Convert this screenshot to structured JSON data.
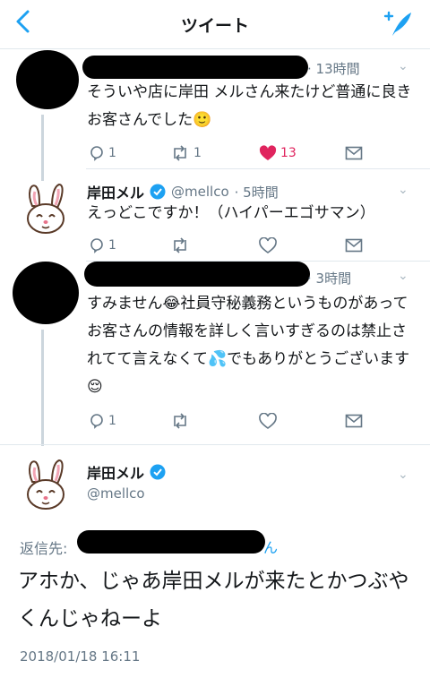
{
  "header": {
    "title": "ツイート"
  },
  "tweets": [
    {
      "time": "· 13時間",
      "text": "そういや店に岸田 メルさん来たけど普通に良きお客さんでした",
      "emoji": "🙂",
      "reply_count": "1",
      "retweet_count": "1",
      "like_count": "13"
    },
    {
      "name": "岸田メル",
      "handle": "@mellco",
      "time": "· 5時間",
      "text": "えっどこですか！（ハイパーエゴサマン）",
      "reply_count": "1"
    },
    {
      "time": "· 3時間",
      "text_a": "すみません",
      "emoji_a": "😂",
      "text_b": "社員守秘義務というものがあってお客さんの情報を詳しく言いすぎるのは禁止されてて言えなくて",
      "emoji_b": "💦",
      "text_c": "でもありがとうございます",
      "emoji_c": "😌",
      "reply_count": "1"
    }
  ],
  "main_tweet": {
    "name": "岸田メル",
    "handle": "@mellco",
    "reply_to_label": "返信先:",
    "reply_to_tail": "ん",
    "text": "アホか、じゃあ岸田メルが来たとかつぶやくんじゃねーよ",
    "timestamp": "2018/01/18 16:11"
  },
  "colors": {
    "accent": "#1da1f2",
    "like": "#e0245e",
    "muted": "#657786"
  }
}
